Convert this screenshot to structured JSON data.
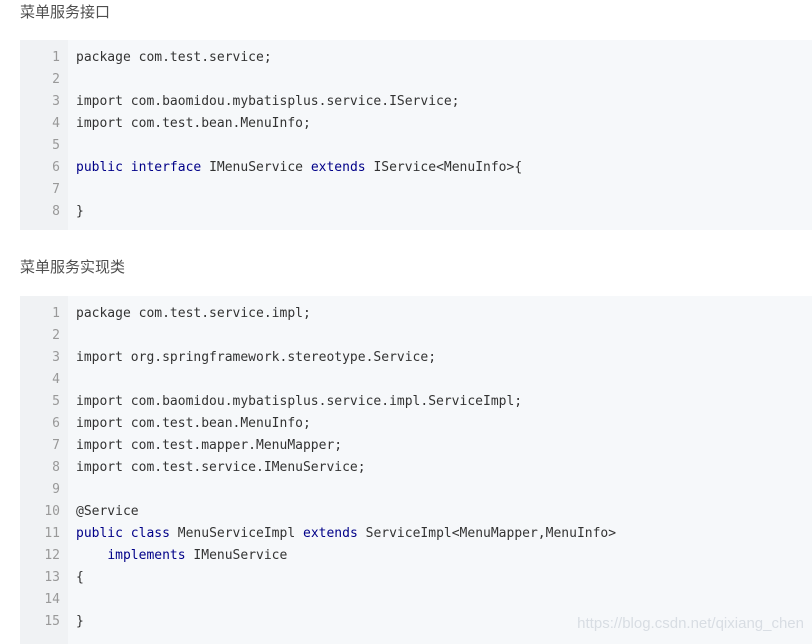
{
  "section1": {
    "heading": "菜单服务接口",
    "lines": [
      {
        "num": "1",
        "parts": [
          {
            "t": "package com.test.service;"
          }
        ]
      },
      {
        "num": "2",
        "parts": []
      },
      {
        "num": "3",
        "parts": [
          {
            "t": "import com.baomidou.mybatisplus.service.IService;"
          }
        ]
      },
      {
        "num": "4",
        "parts": [
          {
            "t": "import com.test.bean.MenuInfo;"
          }
        ]
      },
      {
        "num": "5",
        "parts": []
      },
      {
        "num": "6",
        "parts": [
          {
            "t": "public",
            "kw": true
          },
          {
            "t": " "
          },
          {
            "t": "interface",
            "kw": true
          },
          {
            "t": " IMenuService "
          },
          {
            "t": "extends",
            "kw": true
          },
          {
            "t": " IService<MenuInfo>{"
          }
        ]
      },
      {
        "num": "7",
        "parts": []
      },
      {
        "num": "8",
        "parts": [
          {
            "t": "}"
          }
        ]
      }
    ]
  },
  "section2": {
    "heading": "菜单服务实现类",
    "lines": [
      {
        "num": "1",
        "parts": [
          {
            "t": "package com.test.service.impl;"
          }
        ]
      },
      {
        "num": "2",
        "parts": []
      },
      {
        "num": "3",
        "parts": [
          {
            "t": "import org.springframework.stereotype.Service;"
          }
        ]
      },
      {
        "num": "4",
        "parts": []
      },
      {
        "num": "5",
        "parts": [
          {
            "t": "import com.baomidou.mybatisplus.service.impl.ServiceImpl;"
          }
        ]
      },
      {
        "num": "6",
        "parts": [
          {
            "t": "import com.test.bean.MenuInfo;"
          }
        ]
      },
      {
        "num": "7",
        "parts": [
          {
            "t": "import com.test.mapper.MenuMapper;"
          }
        ]
      },
      {
        "num": "8",
        "parts": [
          {
            "t": "import com.test.service.IMenuService;"
          }
        ]
      },
      {
        "num": "9",
        "parts": []
      },
      {
        "num": "10",
        "parts": [
          {
            "t": "@Service"
          }
        ]
      },
      {
        "num": "11",
        "parts": [
          {
            "t": "public",
            "kw": true
          },
          {
            "t": " "
          },
          {
            "t": "class",
            "kw": true
          },
          {
            "t": " MenuServiceImpl "
          },
          {
            "t": "extends",
            "kw": true
          },
          {
            "t": " ServiceImpl<MenuMapper,MenuInfo>"
          }
        ]
      },
      {
        "num": "12",
        "parts": [
          {
            "t": "    "
          },
          {
            "t": "implements",
            "kw": true
          },
          {
            "t": " IMenuService"
          }
        ]
      },
      {
        "num": "13",
        "parts": [
          {
            "t": "{"
          }
        ]
      },
      {
        "num": "14",
        "parts": []
      },
      {
        "num": "15",
        "parts": [
          {
            "t": "}"
          }
        ]
      }
    ]
  },
  "watermark": "https://blog.csdn.net/qixiang_chen",
  "colors": {
    "keyword": "#000088",
    "code_bg": "#f6f8fa",
    "gutter_bg": "#f0f2f4",
    "line_number": "#999999"
  }
}
